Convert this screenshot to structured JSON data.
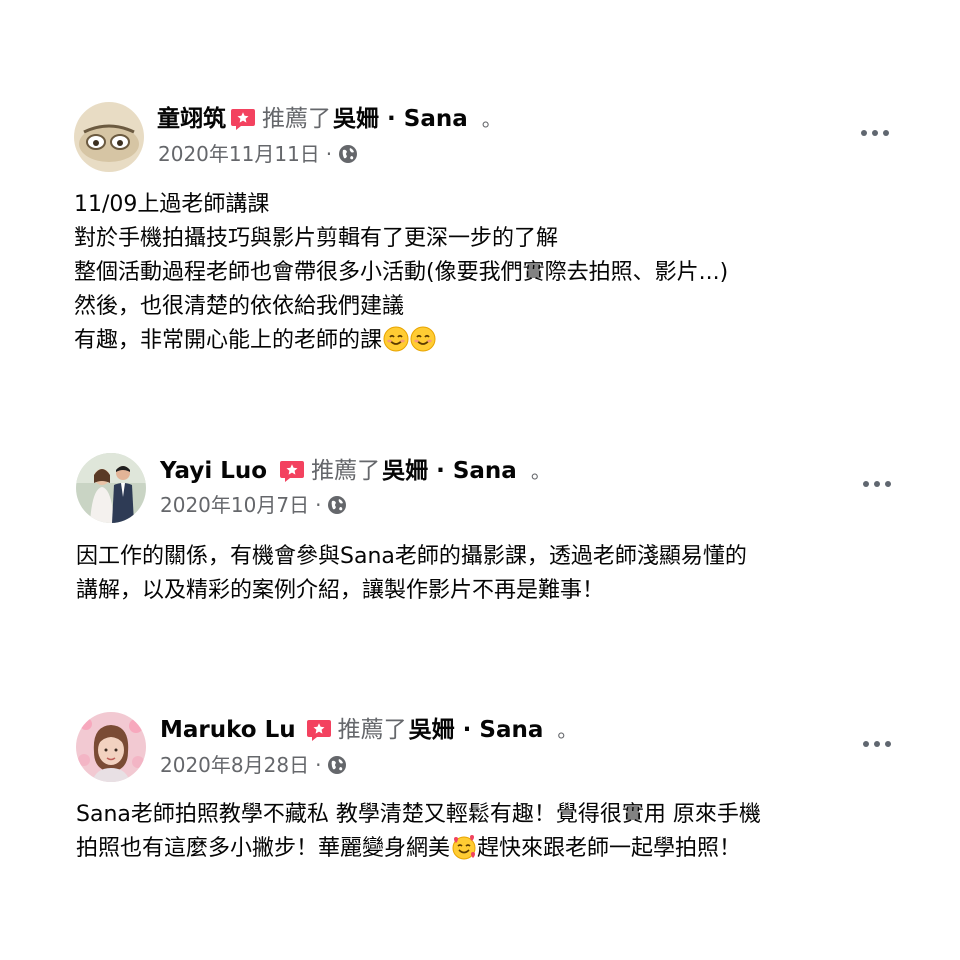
{
  "reviews": [
    {
      "author": "童翊筑",
      "verb": "推薦了",
      "page_name": "吳姍",
      "separator": "·",
      "page_en": "Sana",
      "period": "。",
      "date": "2020年11月11日",
      "meta_dot": "·",
      "privacy_icon": "globe-icon",
      "lines": [
        "11/09上過老師講課",
        "對於手機拍攝技巧與影片剪輯有了更深一步的了解",
        "整個活動過程老師也會帶很多小活動(像要我們實際去拍照、影片...)",
        "然後，也很清楚的依依給我們建議",
        "有趣，非常開心能上的老師的課"
      ],
      "trailing_emoji": [
        "smiling-face-emoji",
        "smiling-face-emoji"
      ]
    },
    {
      "author": "Yayi Luo",
      "verb": "推薦了",
      "page_name": "吳姍",
      "separator": "·",
      "page_en": "Sana",
      "period": "。",
      "date": "2020年10月7日",
      "meta_dot": "·",
      "privacy_icon": "globe-icon",
      "lines": [
        "因工作的關係，有機會參與Sana老師的攝影課，透過老師淺顯易懂的",
        "講解，以及精彩的案例介紹，讓製作影片不再是難事！"
      ]
    },
    {
      "author": "Maruko Lu",
      "verb": "推薦了",
      "page_name": "吳姍",
      "separator": "·",
      "page_en": "Sana",
      "period": "。",
      "date": "2020年8月28日",
      "meta_dot": "·",
      "privacy_icon": "globe-icon",
      "lines_before_emoji": [
        "Sana老師拍照教學不藏私 教學清楚又輕鬆有趣！覺得很實用 原來手機",
        "拍照也有這麼多小撇步！華麗變身網美"
      ],
      "emoji": "smiling-face-with-hearts-emoji",
      "line_after_emoji": "趕快來跟老師一起學拍照！"
    }
  ],
  "colors": {
    "recommend_red": "#f3425f",
    "secondary_text": "#65676b",
    "primary_text": "#050505"
  }
}
